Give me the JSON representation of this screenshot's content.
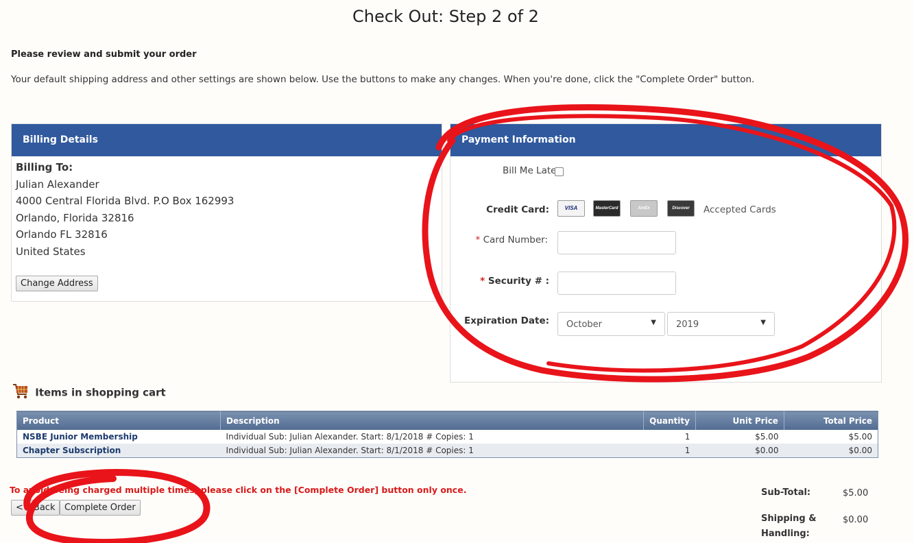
{
  "page": {
    "title": "Check Out: Step 2 of 2",
    "subtitle": "Please review and submit your order",
    "intro": "Your default shipping address and other settings are shown below. Use the buttons to make any changes. When you're done, click the \"Complete Order\" button."
  },
  "billing": {
    "heading": "Billing Details",
    "billing_to_label": "Billing To:",
    "lines": [
      "Julian Alexander",
      "4000 Central Florida Blvd. P.O Box 162993",
      "Orlando, Florida 32816",
      "Orlando FL 32816",
      "United States"
    ],
    "change_address_label": "Change Address"
  },
  "payment": {
    "heading": "Payment Information",
    "bill_me_later_label": "Bill Me Later",
    "credit_card_label": "Credit Card:",
    "cards": [
      "VISA",
      "MasterCard",
      "AmEx",
      "Discover"
    ],
    "accepted_cards_label": "Accepted Cards",
    "card_number_label": "Card Number:",
    "security_label": "Security # :",
    "required_mark": "*",
    "expiration_label": "Expiration Date:",
    "exp_month": "October",
    "exp_year": "2019",
    "card_number_value": "",
    "security_value": ""
  },
  "cart": {
    "heading": "Items in shopping cart",
    "columns": [
      "Product",
      "Description",
      "Quantity",
      "Unit Price",
      "Total Price"
    ],
    "rows": [
      {
        "product": "NSBE Junior Membership",
        "description": "Individual Sub: Julian Alexander. Start: 8/1/2018 # Copies: 1",
        "quantity": "1",
        "unit_price": "$5.00",
        "total_price": "$5.00"
      },
      {
        "product": "Chapter Subscription",
        "description": "Individual Sub: Julian Alexander. Start: 8/1/2018 # Copies: 1",
        "quantity": "1",
        "unit_price": "$0.00",
        "total_price": "$0.00"
      }
    ]
  },
  "footer": {
    "warning": "To avoid being charged multiple times, please click on the [Complete Order] button only once.",
    "back_label": "<< Back",
    "complete_label": "Complete Order"
  },
  "totals": {
    "subtotal_label": "Sub-Total:",
    "subtotal_value": "$5.00",
    "shipping_label_1": "Shipping &",
    "shipping_label_2": "Handling:",
    "shipping_value": "$0.00"
  },
  "colors": {
    "panel_header": "#30599e",
    "annotation_red": "#e8141a",
    "warning_red": "#d81a1a"
  },
  "icons": [
    "shopping-cart-icon",
    "select-arrow-icon",
    "visa-card-icon",
    "mastercard-card-icon",
    "amex-card-icon",
    "discover-card-icon"
  ]
}
